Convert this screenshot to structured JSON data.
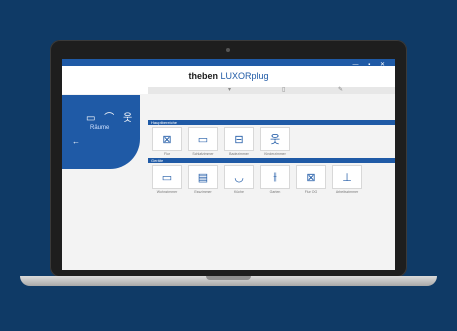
{
  "window": {
    "controls": "— ▪ ✕"
  },
  "brand": {
    "bold": "theben",
    "light": "LUXORplug"
  },
  "tabs": [
    "▾",
    "▯",
    "✎"
  ],
  "sidebar": {
    "icons": "▭ ⌒ 웃",
    "label": "Räume",
    "back_icon": "←"
  },
  "sections": [
    {
      "title": "Hauptbereiche",
      "items": [
        {
          "icon": "⊠",
          "label": "Flur"
        },
        {
          "icon": "▭",
          "label": "Schlafzimmer"
        },
        {
          "icon": "⊟",
          "label": "Badezimmer"
        },
        {
          "icon": "웃",
          "label": "Kinderzimmer"
        }
      ]
    },
    {
      "title": "Geräte",
      "items": [
        {
          "icon": "▭",
          "label": "Wohnzimmer"
        },
        {
          "icon": "▤",
          "label": "Esszimmer"
        },
        {
          "icon": "◡",
          "label": "Küche"
        },
        {
          "icon": "⫲",
          "label": "Garten"
        },
        {
          "icon": "⊠",
          "label": "Flur OG"
        },
        {
          "icon": "⊥",
          "label": "Arbeitszimmer"
        }
      ]
    }
  ]
}
